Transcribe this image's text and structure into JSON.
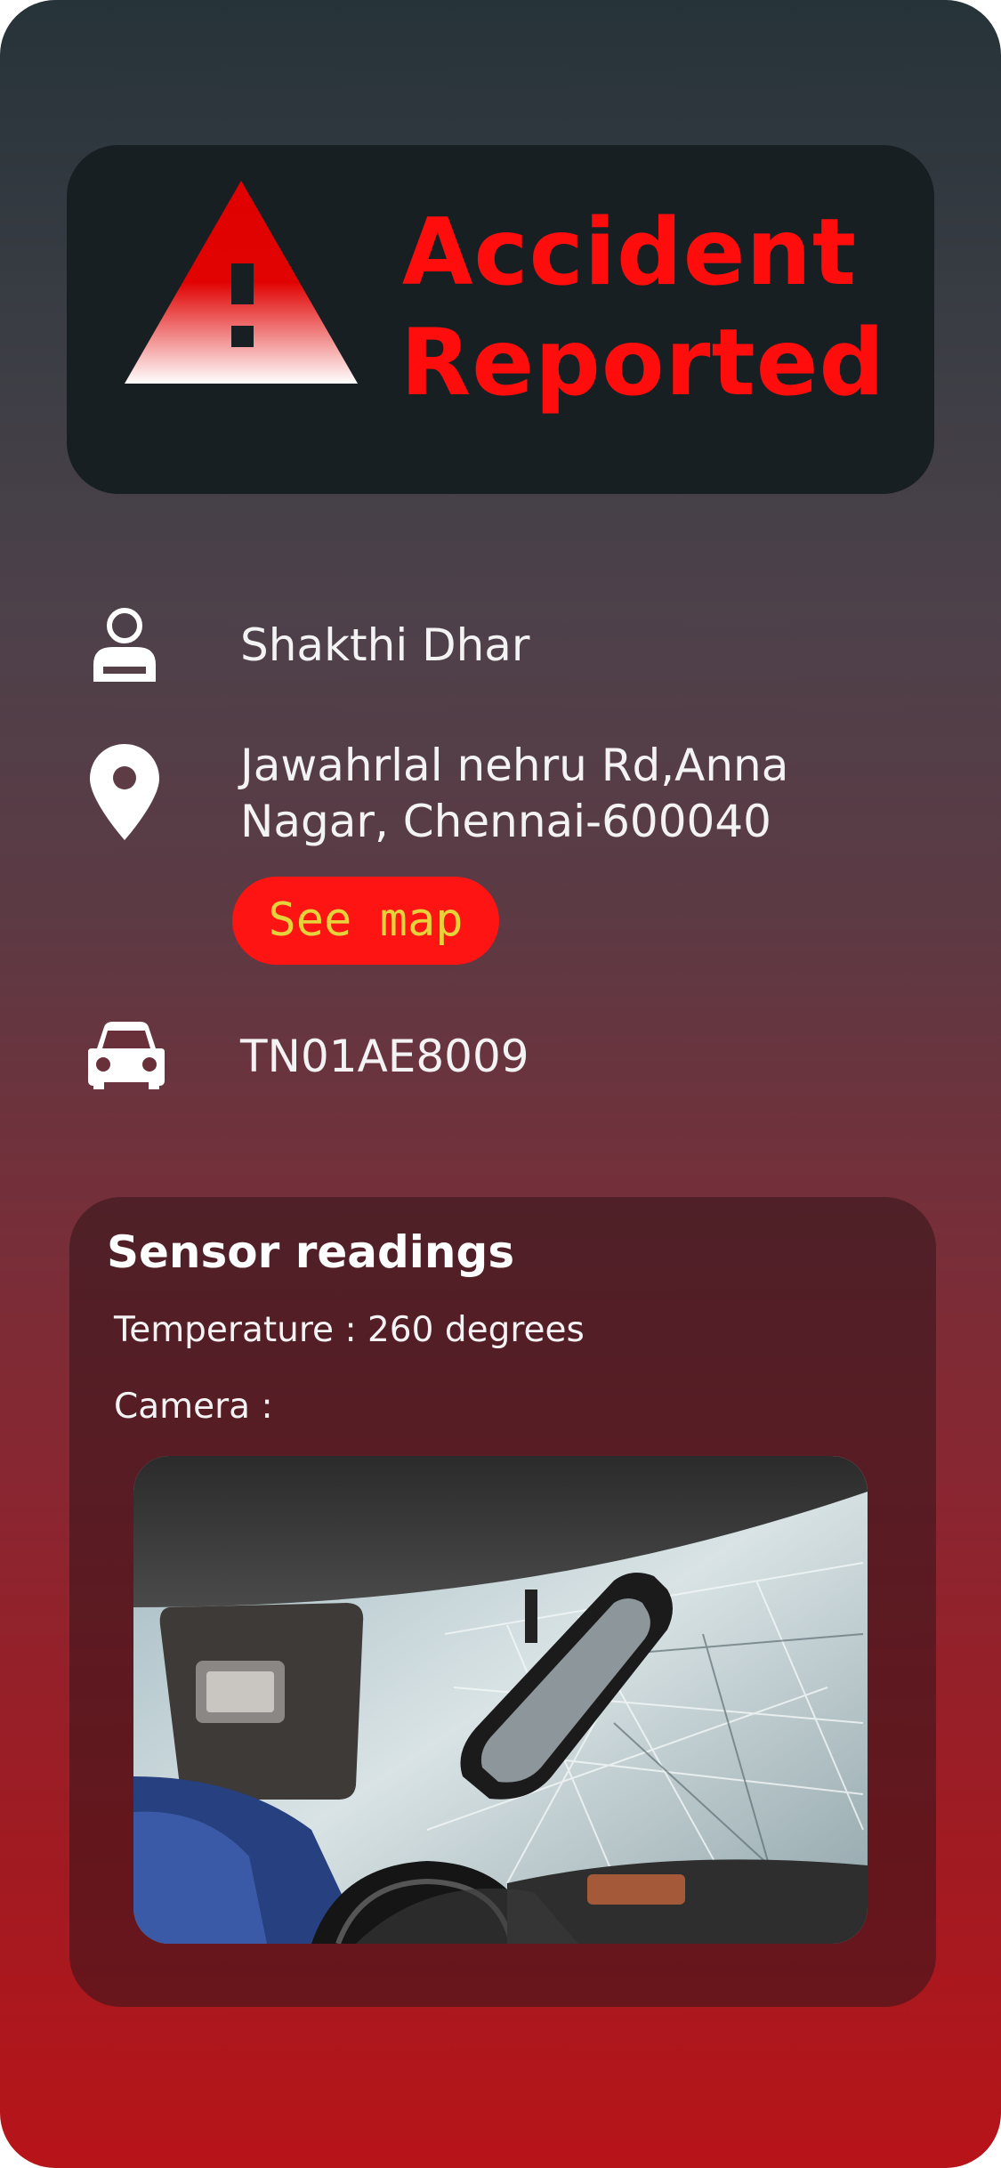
{
  "alert": {
    "title_line1": "Accident",
    "title_line2": "Reported",
    "icon": "warning-triangle-icon",
    "color": "#ff0d0d"
  },
  "victim": {
    "icon": "user-icon",
    "name": "Shakthi Dhar"
  },
  "location": {
    "icon": "location-pin-icon",
    "address_line1": "Jawahrlal nehru Rd,Anna",
    "address_line2": "Nagar, Chennai-600040",
    "map_button": "See map"
  },
  "vehicle": {
    "icon": "car-icon",
    "plate": "TN01AE8009"
  },
  "sensors": {
    "title": "Sensor readings",
    "temperature": "Temperature : 260 degrees",
    "camera_label": "Camera :",
    "camera_image": "crash-photo"
  },
  "colors": {
    "accent_red": "#ff1414",
    "button_text": "#e6d23a",
    "card_dark": "#181f23"
  }
}
